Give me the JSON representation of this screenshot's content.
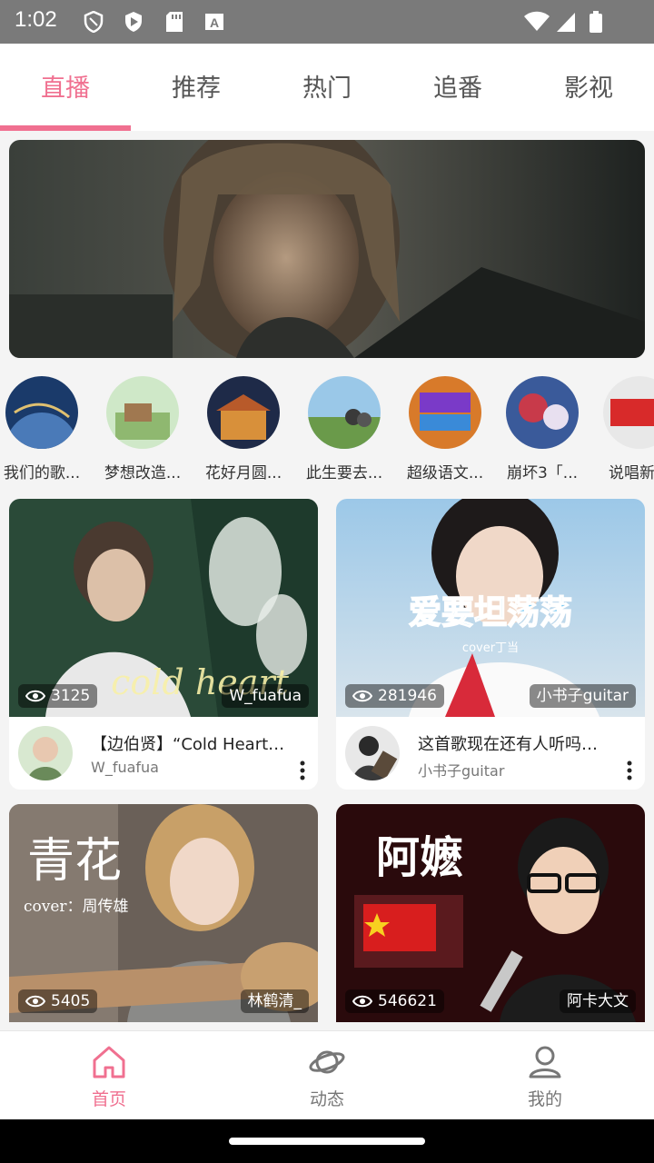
{
  "status_bar": {
    "time": "1:02"
  },
  "tabs": [
    {
      "label": "直播",
      "active": true
    },
    {
      "label": "推荐",
      "active": false
    },
    {
      "label": "热门",
      "active": false
    },
    {
      "label": "追番",
      "active": false
    },
    {
      "label": "影视",
      "active": false
    }
  ],
  "channels": [
    {
      "label": "我们的歌..."
    },
    {
      "label": "梦想改造..."
    },
    {
      "label": "花好月圆..."
    },
    {
      "label": "此生要去..."
    },
    {
      "label": "超级语文..."
    },
    {
      "label": "崩坏3「..."
    },
    {
      "label": "说唱新世"
    }
  ],
  "videos": [
    {
      "views": "3125",
      "badge": "W_fuafua",
      "title": "【边伯贤】“Cold Heart…",
      "author": "W_fuafua",
      "overlay": "cold heart"
    },
    {
      "views": "281946",
      "badge": "小书子guitar",
      "title": "这首歌现在还有人听吗…",
      "author": "小书子guitar",
      "overlay": "爱要坦荡荡",
      "overlay_sub": "cover丁当"
    },
    {
      "views": "5405",
      "badge": "林鹤清_",
      "overlay": "青花",
      "overlay_sub": "cover：周传雄"
    },
    {
      "views": "546621",
      "badge": "阿卡大文",
      "overlay": "阿嬷"
    }
  ],
  "bottom_nav": [
    {
      "label": "首页",
      "active": true,
      "icon": "home-icon"
    },
    {
      "label": "动态",
      "active": false,
      "icon": "planet-icon"
    },
    {
      "label": "我的",
      "active": false,
      "icon": "person-icon"
    }
  ],
  "colors": {
    "accent": "#f07090",
    "status_bar": "#7a7a7a"
  }
}
